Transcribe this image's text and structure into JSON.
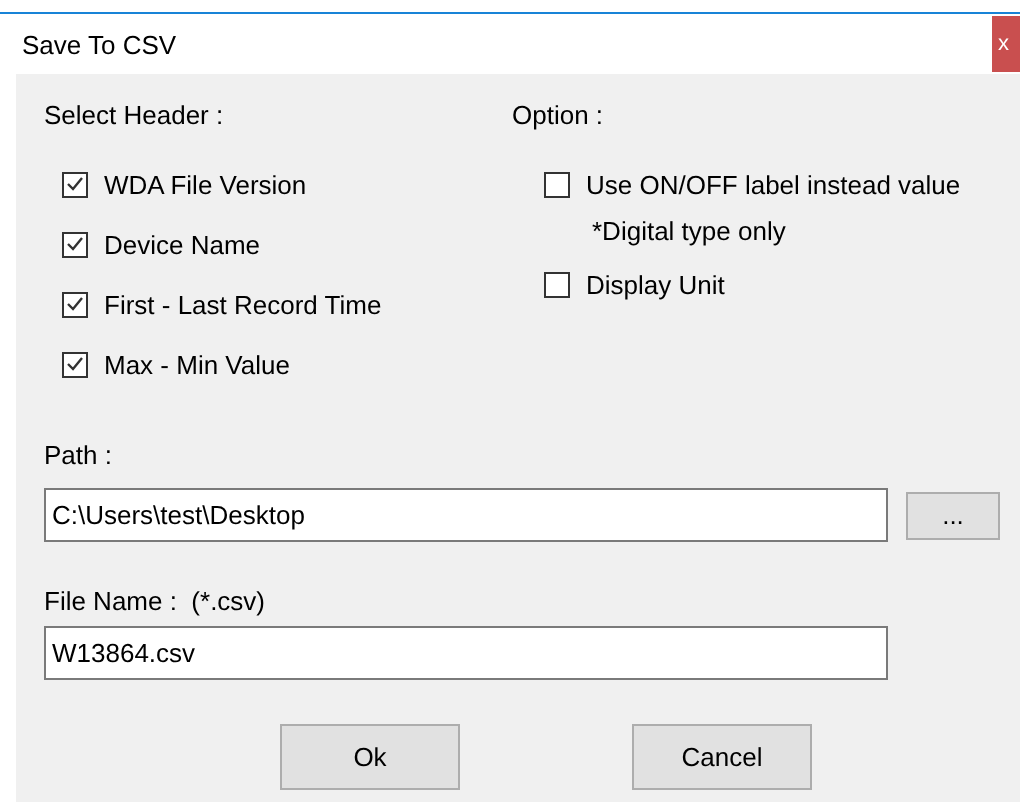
{
  "window": {
    "title": "Save To CSV",
    "close": "x"
  },
  "header_section": {
    "label": "Select Header :",
    "items": [
      {
        "label": "WDA File Version",
        "checked": true
      },
      {
        "label": "Device Name",
        "checked": true
      },
      {
        "label": "First - Last Record Time",
        "checked": true
      },
      {
        "label": "Max - Min Value",
        "checked": true
      }
    ]
  },
  "option_section": {
    "label": "Option :",
    "items": [
      {
        "kind": "checkbox",
        "label": "Use ON/OFF label instead value",
        "checked": false
      },
      {
        "kind": "note",
        "label": "*Digital type only"
      },
      {
        "kind": "checkbox",
        "label": "Display Unit",
        "checked": false
      }
    ]
  },
  "path": {
    "label": "Path :",
    "value": "C:\\Users\\test\\Desktop",
    "browse": "..."
  },
  "file_name": {
    "label": "File Name :  (*.csv)",
    "value": "W13864.csv"
  },
  "buttons": [
    "Ok",
    "Cancel"
  ]
}
